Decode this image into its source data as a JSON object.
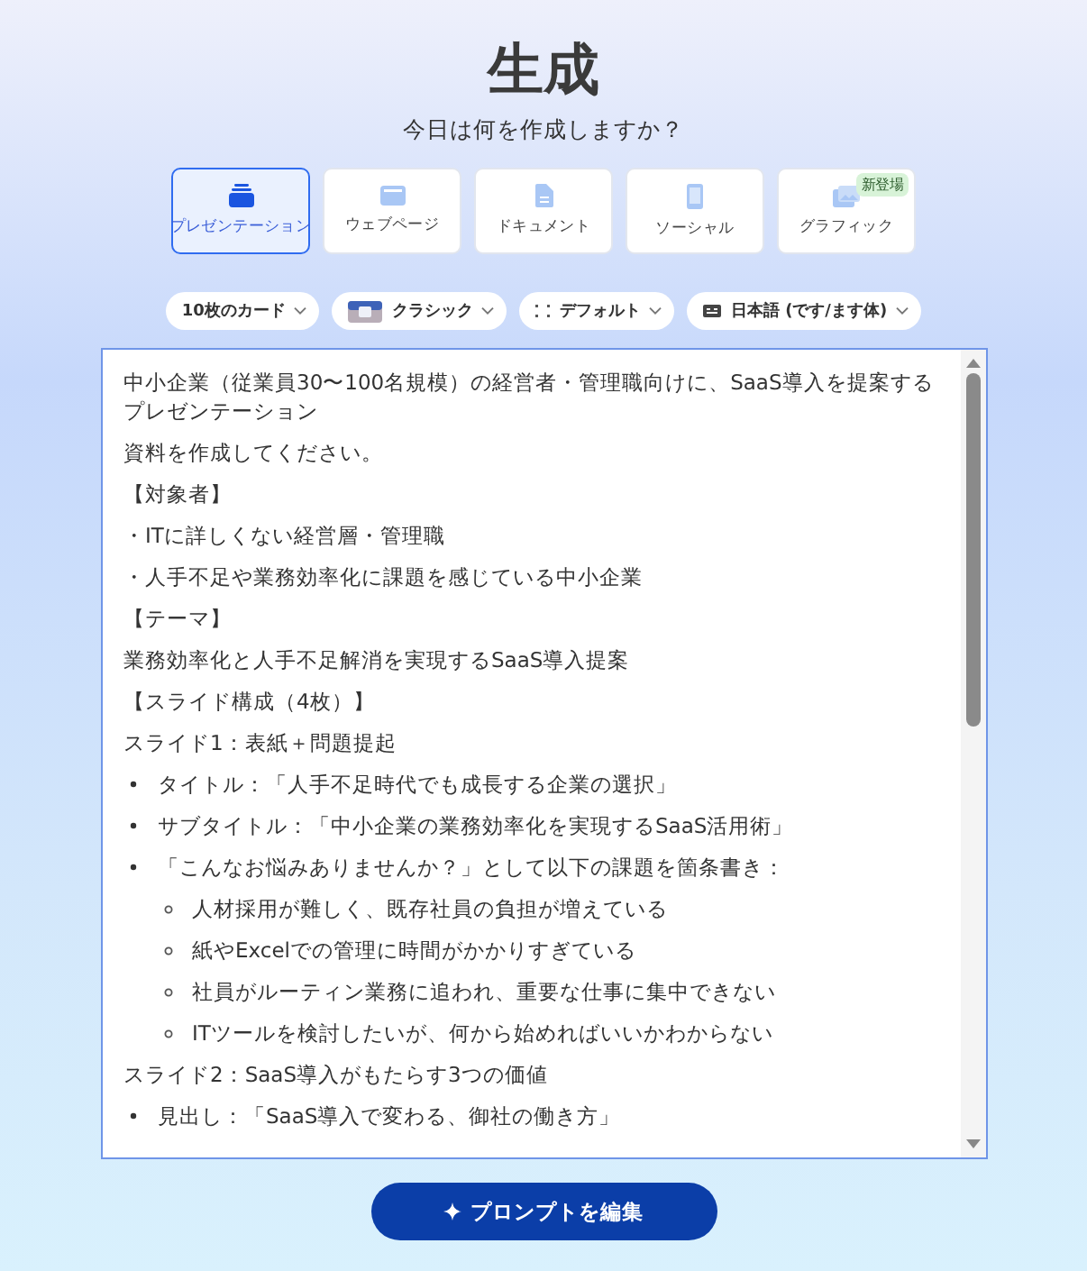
{
  "title": "生成",
  "subtitle": "今日は何を作成しますか？",
  "types": [
    {
      "kind": "presentation",
      "label": "プレゼンテーション",
      "selected": true
    },
    {
      "kind": "webpage",
      "label": "ウェブページ",
      "selected": false
    },
    {
      "kind": "document",
      "label": "ドキュメント",
      "selected": false
    },
    {
      "kind": "social",
      "label": "ソーシャル",
      "selected": false
    },
    {
      "kind": "graphic",
      "label": "グラフィック",
      "selected": false,
      "badge": "新登場"
    }
  ],
  "options": [
    {
      "kind": "cards",
      "label": "10枚のカード"
    },
    {
      "kind": "theme",
      "label": "クラシック"
    },
    {
      "kind": "layout",
      "label": "デフォルト"
    },
    {
      "kind": "language",
      "label": "日本語 (です/ます体)"
    }
  ],
  "prompt_lines": [
    {
      "kind": "para",
      "text": "中小企業（従業員30〜100名規模）の経営者・管理職向けに、SaaS導入を提案するプレゼンテーション"
    },
    {
      "kind": "para",
      "text": "資料を作成してください。"
    },
    {
      "kind": "para",
      "text": "【対象者】"
    },
    {
      "kind": "para",
      "text": "・ITに詳しくない経営層・管理職"
    },
    {
      "kind": "para",
      "text": "・人手不足や業務効率化に課題を感じている中小企業"
    },
    {
      "kind": "para",
      "text": "【テーマ】"
    },
    {
      "kind": "para",
      "text": "業務効率化と人手不足解消を実現するSaaS導入提案"
    },
    {
      "kind": "para",
      "text": "【スライド構成（4枚）】"
    },
    {
      "kind": "para",
      "text": "スライド1：表紙＋問題提起"
    },
    {
      "kind": "bullet",
      "text": "タイトル：「人手不足時代でも成長する企業の選択」"
    },
    {
      "kind": "bullet",
      "text": "サブタイトル：「中小企業の業務効率化を実現するSaaS活用術」"
    },
    {
      "kind": "bullet",
      "text": "「こんなお悩みありませんか？」として以下の課題を箇条書き："
    },
    {
      "kind": "subbullet",
      "text": "人材採用が難しく、既存社員の負担が増えている"
    },
    {
      "kind": "subbullet",
      "text": "紙やExcelでの管理に時間がかかりすぎている"
    },
    {
      "kind": "subbullet",
      "text": "社員がルーティン業務に追われ、重要な仕事に集中できない"
    },
    {
      "kind": "subbullet",
      "text": "ITツールを検討したいが、何から始めればいいかわからない"
    },
    {
      "kind": "para",
      "text": "スライド2：SaaS導入がもたらす3つの価値"
    },
    {
      "kind": "bullet",
      "text": "見出し：「SaaS導入で変わる、御社の働き方」"
    }
  ],
  "edit_button": "プロンプトを編集"
}
